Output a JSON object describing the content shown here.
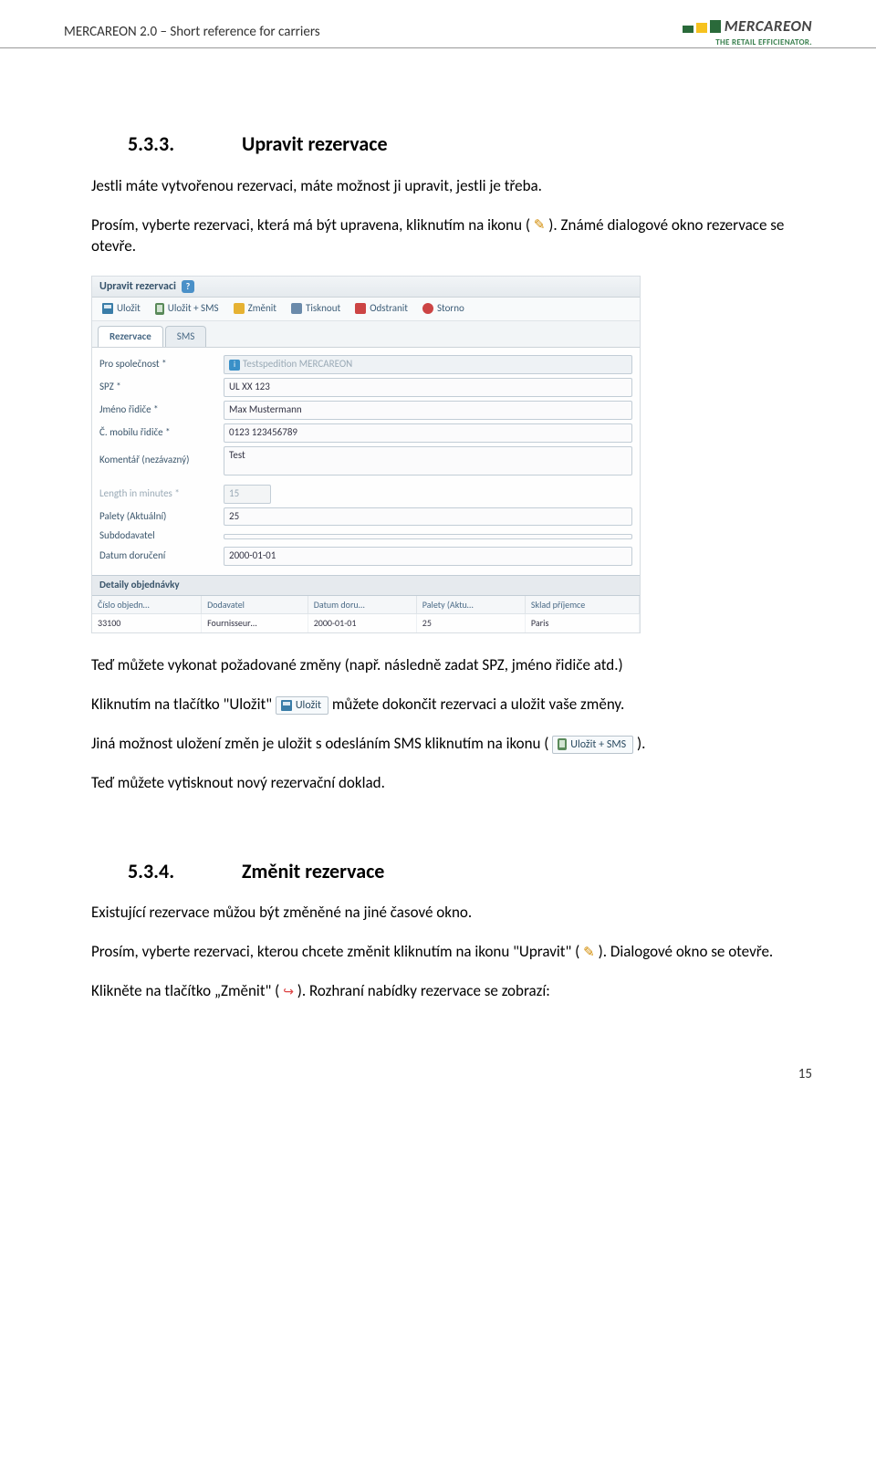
{
  "header": {
    "doc_title": "MERCAREON 2.0 – Short reference for carriers",
    "logo_text": "MERCAREON",
    "logo_tagline": "THE RETAIL EFFICIENATOR."
  },
  "sec1": {
    "num": "5.3.3.",
    "title": "Upravit rezervace",
    "p1": "Jestli máte vytvořenou rezervaci, máte možnost ji upravit, jestli je třeba.",
    "p2a": "Prosím, vyberte rezervaci, která má být upravena, kliknutím na ikonu (",
    "p2b": "). Známé dialogové okno rezervace se otevře.",
    "p3": "Teď můžete vykonat požadované změny (např. následně zadat SPZ, jméno řidiče atd.)",
    "p4a": "Kliknutím na tlačítko \"Uložit\" ",
    "p4b": " můžete dokončit rezervaci a uložit vaše změny.",
    "p5a": "Jiná možnost uložení změn je uložit s odesláním SMS kliknutím na ikonu (",
    "p5b": ").",
    "p6": "Teď můžete vytisknout nový rezervační doklad."
  },
  "btns": {
    "save": "Uložit",
    "save_sms": "Uložit + SMS"
  },
  "shot": {
    "title": "Upravit rezervaci",
    "toolbar": {
      "save": "Uložit",
      "save_sms": "Uložit + SMS",
      "edit": "Změnit",
      "print": "Tisknout",
      "delete": "Odstranit",
      "cancel": "Storno"
    },
    "tabs": {
      "reservation": "Rezervace",
      "sms": "SMS"
    },
    "fields": {
      "company_lbl": "Pro společnost *",
      "company_val": "Testspedition MERCAREON",
      "spz_lbl": "SPZ *",
      "spz_val": "UL XX 123",
      "driver_lbl": "Jméno řidiče *",
      "driver_val": "Max Mustermann",
      "mobile_lbl": "Č. mobilu řidiče *",
      "mobile_val": "0123 123456789",
      "comment_lbl": "Komentář (nezávazný)",
      "comment_val": "Test",
      "length_lbl": "Length in minutes *",
      "length_val": "15",
      "pallets_lbl": "Palety (Aktuální)",
      "pallets_val": "25",
      "sub_lbl": "Subdodavatel",
      "date_lbl": "Datum doručení",
      "date_val": "2000-01-01"
    },
    "order_details": {
      "header": "Detaily objednávky",
      "cols": {
        "c1": "Číslo objedn…",
        "c2": "Dodavatel",
        "c3": "Datum doru…",
        "c4": "Palety (Aktu…",
        "c5": "Sklad příjemce"
      },
      "row": {
        "c1": "33100",
        "c2": "Fournisseur…",
        "c3": "2000-01-01",
        "c4": "25",
        "c5": "Paris"
      }
    }
  },
  "sec2": {
    "num": "5.3.4.",
    "title": "Změnit rezervace",
    "p1": "Existující rezervace můžou být změněné na jiné časové okno.",
    "p2a": "Prosím, vyberte rezervaci, kterou chcete změnit kliknutím na ikonu \"Upravit\" (",
    "p2b": "). Dialogové okno se otevře.",
    "p3a": "Klikněte na tlačítko „Změnit\" (",
    "p3b": "). Rozhraní nabídky rezervace se zobrazí:"
  },
  "page_number": "15"
}
